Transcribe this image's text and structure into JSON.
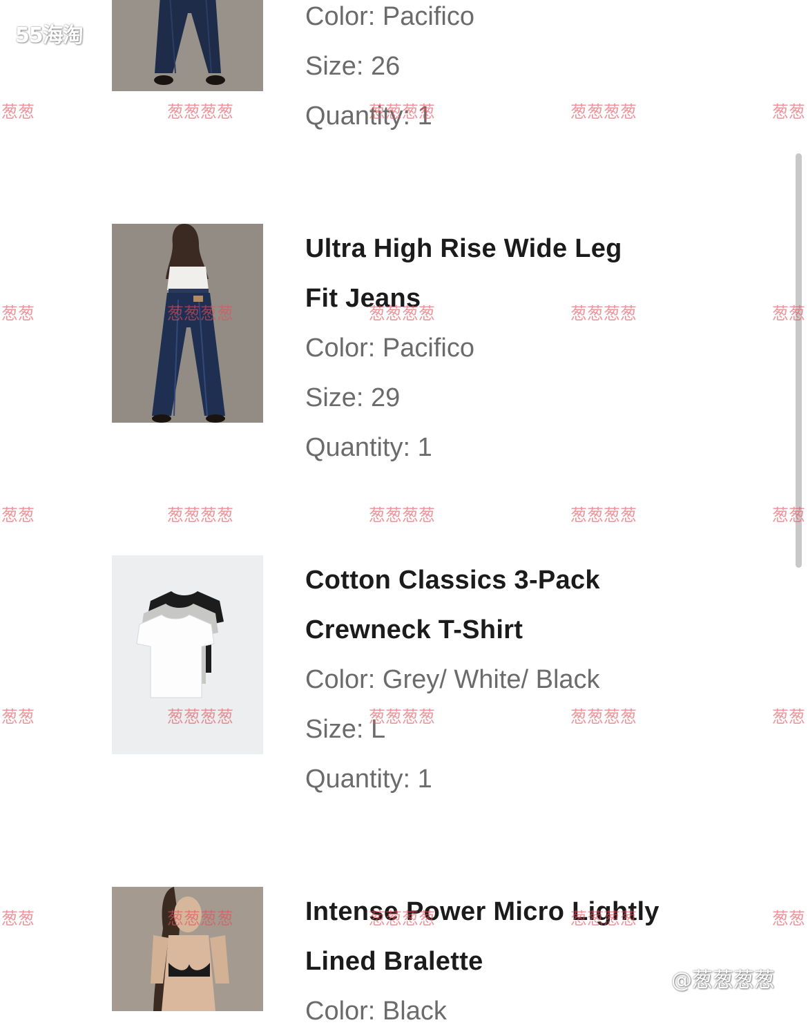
{
  "overlay": {
    "site_logo": "55海淘",
    "author_mark": "@葱葱葱葱",
    "watermark_edge": "葱葱",
    "watermark_text": "葱葱葱葱"
  },
  "items": [
    {
      "title_line1": "",
      "title_line2": "",
      "color": "Color: Pacifico",
      "size": "Size: 26",
      "quantity": "Quantity: 1",
      "image_icon": "jeans-photo-icon"
    },
    {
      "title_line1": "Ultra High Rise Wide Leg",
      "title_line2": "Fit Jeans",
      "color": "Color: Pacifico",
      "size": "Size: 29",
      "quantity": "Quantity: 1",
      "image_icon": "jeans-photo-icon"
    },
    {
      "title_line1": "Cotton Classics 3-Pack",
      "title_line2": "Crewneck T-Shirt",
      "color": "Color: Grey/ White/ Black",
      "size": "Size: L",
      "quantity": "Quantity: 1",
      "image_icon": "tshirt-photo-icon"
    },
    {
      "title_line1": "Intense Power Micro Lightly",
      "title_line2": "Lined Bralette",
      "color": "Color: Black",
      "size": "",
      "quantity": "",
      "image_icon": "bralette-photo-icon"
    }
  ]
}
